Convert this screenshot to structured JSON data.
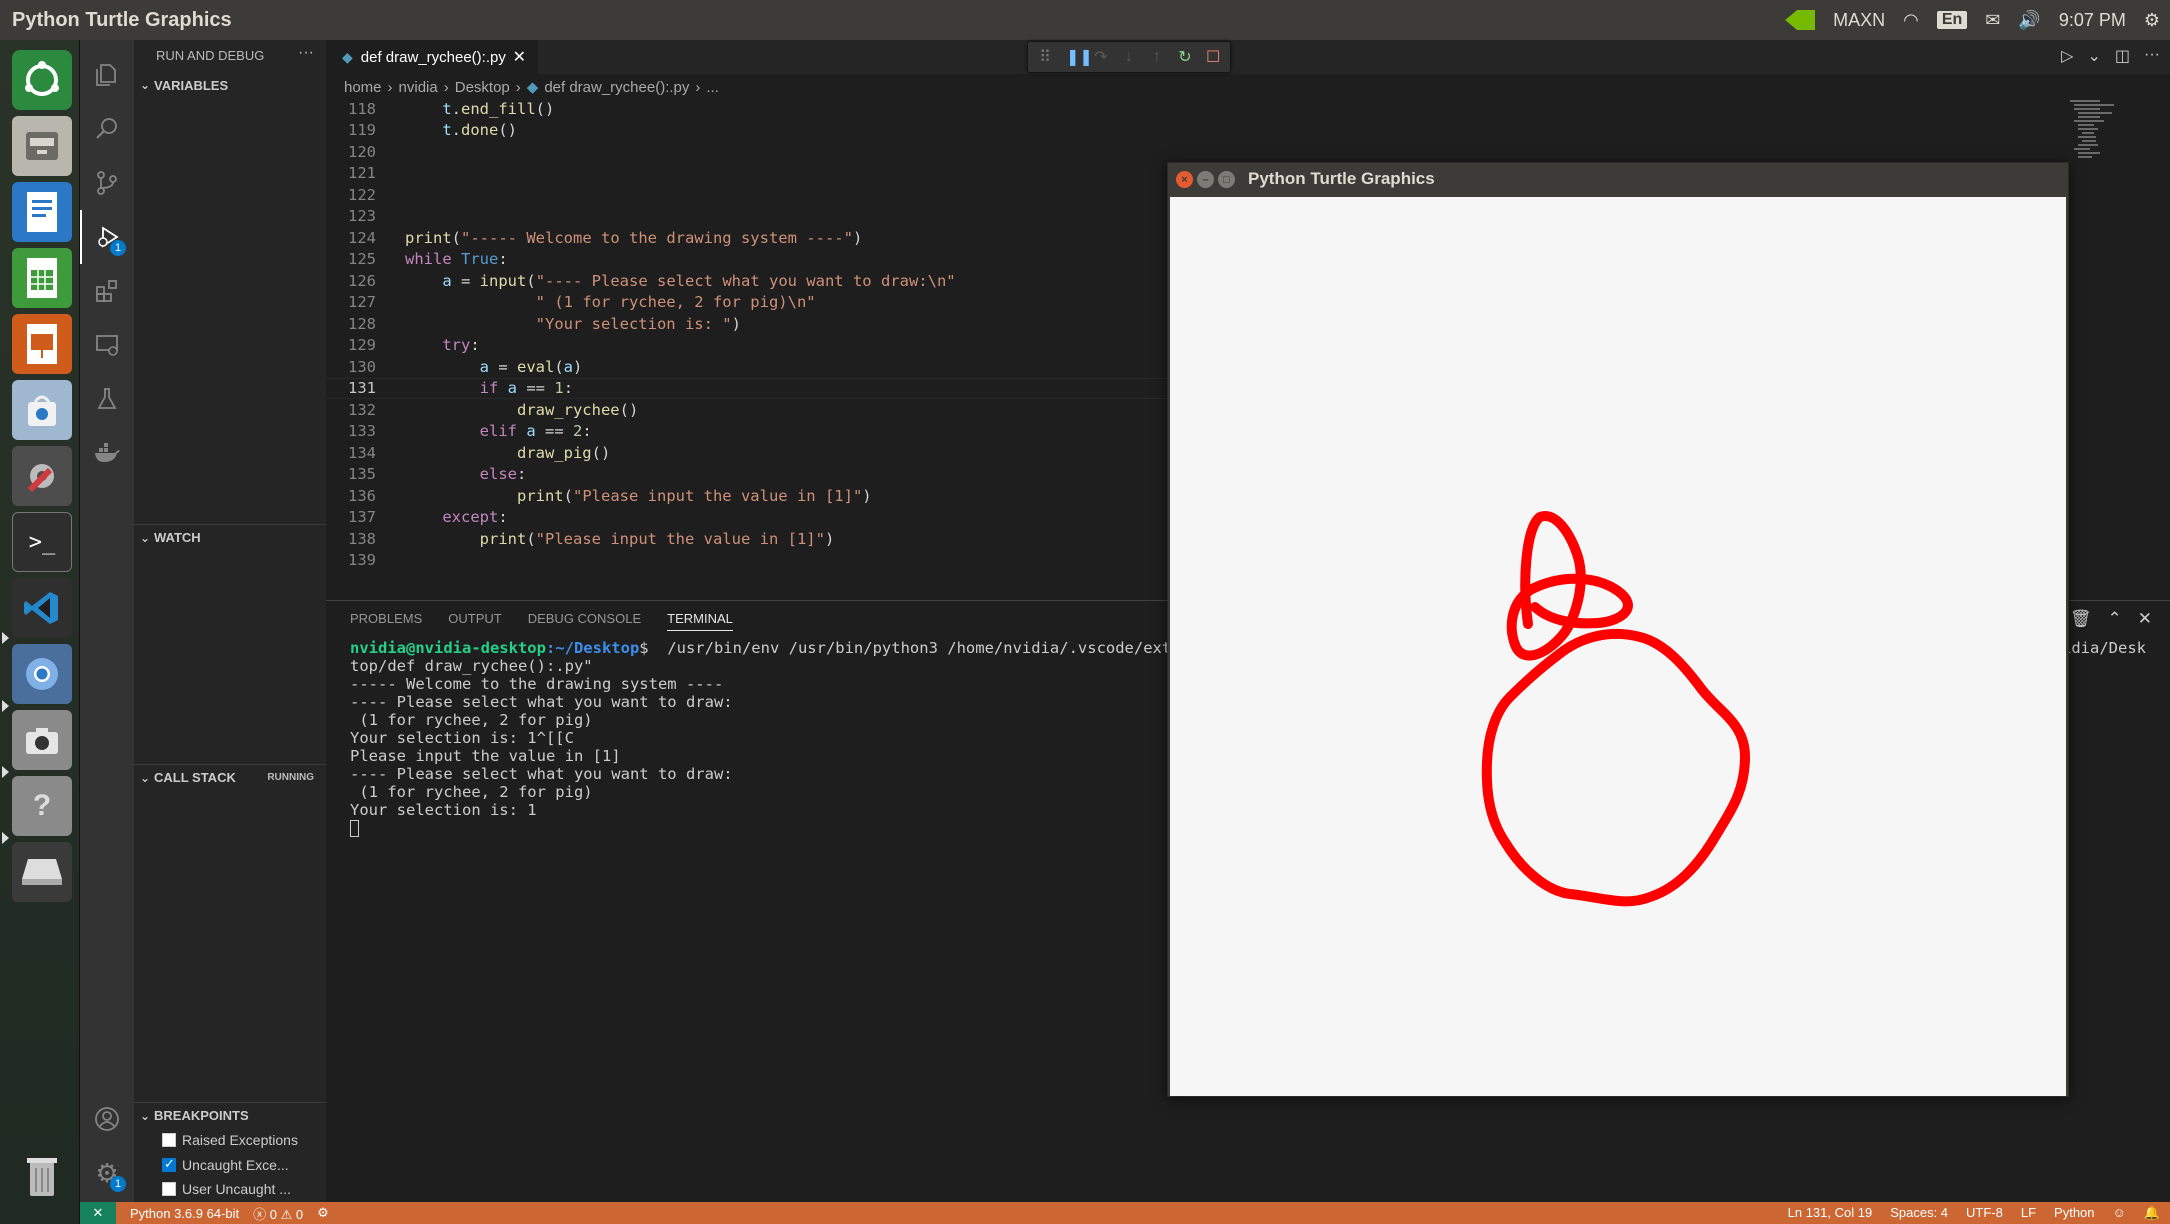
{
  "topbar": {
    "app_title": "Python Turtle Graphics",
    "nvidia_mode": "MAXN",
    "keyboard_lang": "En",
    "clock": "9:07 PM"
  },
  "sidebar": {
    "header": "RUN AND DEBUG",
    "variables": "VARIABLES",
    "watch": "WATCH",
    "call_stack": "CALL STACK",
    "call_stack_state": "RUNNING",
    "breakpoints": "BREAKPOINTS",
    "bp_items": [
      {
        "label": "Raised Exceptions",
        "checked": false
      },
      {
        "label": "Uncaught Exce...",
        "checked": true
      },
      {
        "label": "User Uncaught ...",
        "checked": false
      }
    ]
  },
  "activity": {
    "debug_badge": "1",
    "settings_badge": "1"
  },
  "editor": {
    "tab_label": "def draw_rychee():.py",
    "breadcrumb": [
      "home",
      "nvidia",
      "Desktop",
      "def draw_rychee():.py",
      "..."
    ],
    "current_line": 131
  },
  "panel": {
    "tabs": [
      "PROBLEMS",
      "OUTPUT",
      "DEBUG CONSOLE",
      "TERMINAL"
    ],
    "active_tab": "TERMINAL",
    "prompt_user": "nvidia@nvidia-desktop",
    "prompt_path": ":~/Desktop",
    "prompt_sym": "$ ",
    "command": " /usr/bin/env /usr/bin/python3 /home/nvidia/.vscode/extens",
    "command_tail": "idia/Desk",
    "lines": [
      "top/def draw_rychee():.py\"",
      "----- Welcome to the drawing system ----",
      "---- Please select what you want to draw:",
      " (1 for rychee, 2 for pig)",
      "Your selection is: 1^[[C",
      "Please input the value in [1]",
      "---- Please select what you want to draw:",
      " (1 for rychee, 2 for pig)",
      "Your selection is: 1"
    ]
  },
  "status": {
    "python": "Python 3.6.9 64-bit",
    "errors": "0",
    "warnings": "0",
    "position": "Ln 131, Col 19",
    "spaces": "Spaces: 4",
    "encoding": "UTF-8",
    "eol": "LF",
    "language": "Python"
  },
  "turtle_window": {
    "title": "Python Turtle Graphics",
    "stroke_color": "#ff0000"
  },
  "colors": {
    "status_bar": "#cc6633",
    "accent": "#007acc"
  }
}
